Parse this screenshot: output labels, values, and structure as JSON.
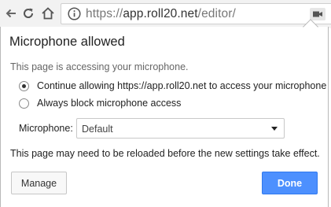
{
  "toolbar": {
    "back_icon": "back-arrow-icon",
    "reload_icon": "reload-icon",
    "home_icon": "home-icon",
    "info_icon": "info-icon",
    "url_prefix": "https://",
    "url_host": "app.roll20.net",
    "url_path": "/editor/",
    "camera_icon": "camera-blocked-icon"
  },
  "bubble": {
    "title": "Microphone allowed",
    "subtitle": "This page is accessing your microphone.",
    "options": [
      {
        "label": "Continue allowing https://app.roll20.net to access your microphone",
        "selected": true
      },
      {
        "label": "Always block microphone access",
        "selected": false
      }
    ],
    "microphone_label": "Microphone:",
    "microphone_selected": "Default",
    "reload_note": "This page may need to be reloaded before the new settings take effect.",
    "manage_label": "Manage",
    "done_label": "Done"
  },
  "colors": {
    "accent": "#4d90fe",
    "toolbar_bg": "#f2f2f2"
  }
}
